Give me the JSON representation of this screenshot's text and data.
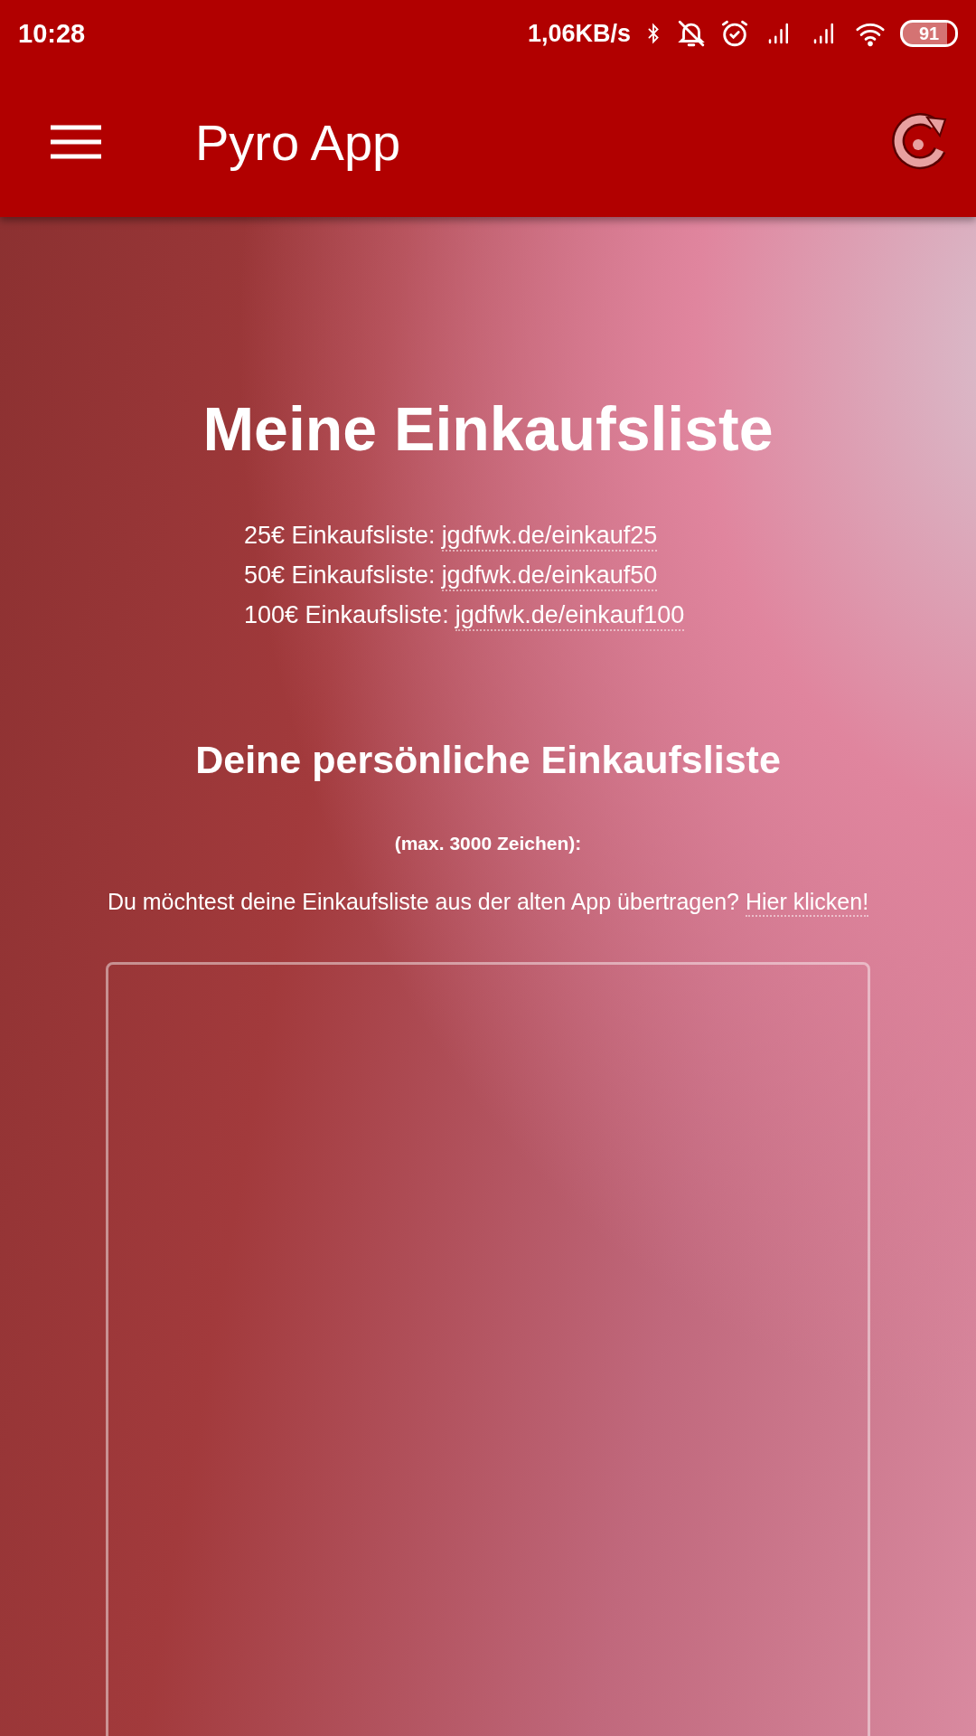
{
  "status_bar": {
    "time": "10:28",
    "network_speed": "1,06KB/s",
    "battery": "91"
  },
  "app_bar": {
    "title": "Pyro App"
  },
  "content": {
    "title": "Meine Einkaufsliste",
    "lists": [
      {
        "label": "25€ Einkaufsliste:",
        "link": "jgdfwk.de/einkauf25"
      },
      {
        "label": "50€ Einkaufsliste:",
        "link": "jgdfwk.de/einkauf50"
      },
      {
        "label": "100€ Einkaufsliste:",
        "link": "jgdfwk.de/einkauf100"
      }
    ],
    "personal_heading": "Deine persönliche Einkaufsliste",
    "limit_note": "(max. 3000 Zeichen):",
    "transfer_text": "Du möchtest deine Einkaufsliste aus der alten App übertragen?",
    "transfer_link": "Hier klicken!"
  }
}
